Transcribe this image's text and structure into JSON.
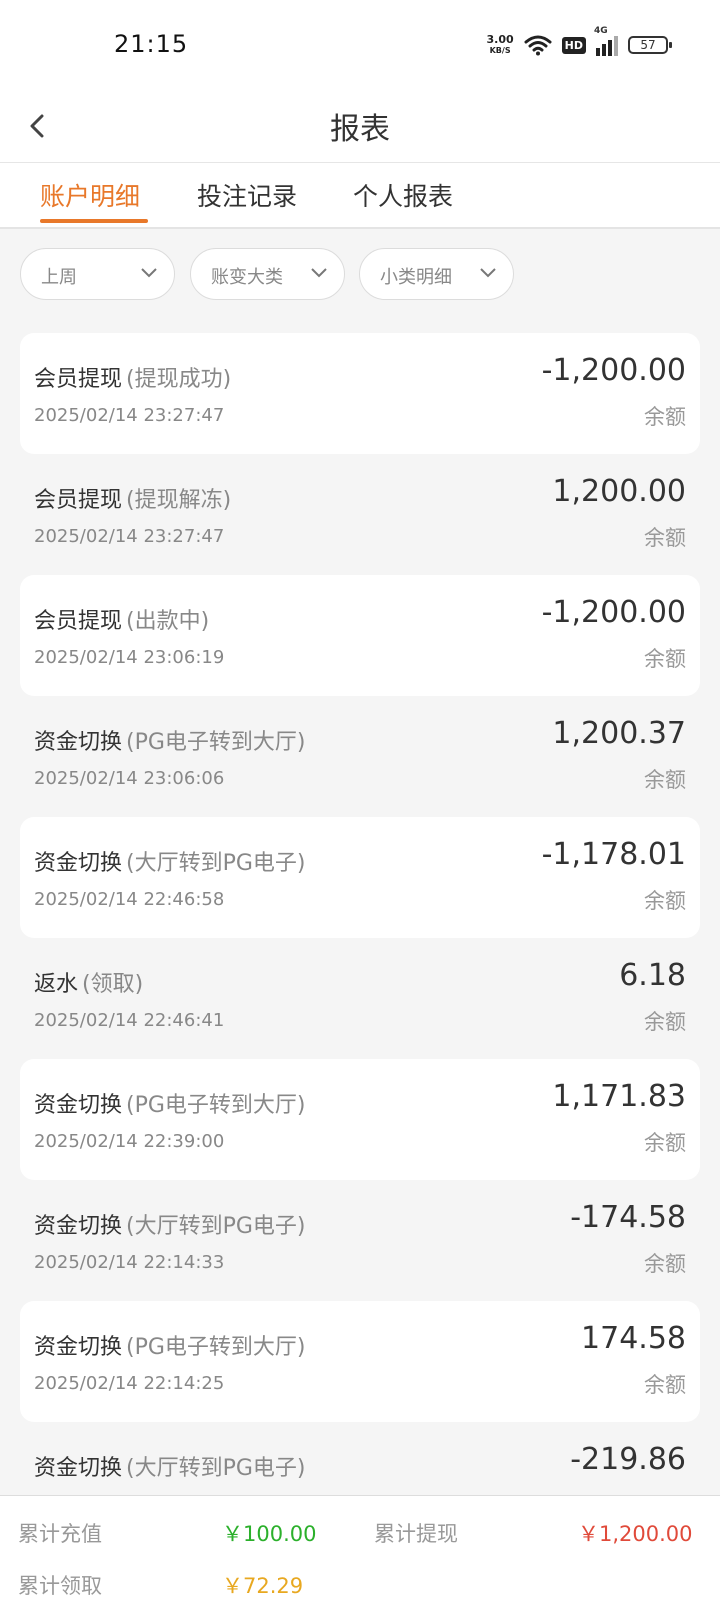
{
  "status_bar": {
    "time": "21:15",
    "net_speed_value": "3.00",
    "net_speed_unit": "KB/S",
    "hd_label": "HD",
    "network_label": "4G",
    "battery": "57"
  },
  "header": {
    "title": "报表"
  },
  "tabs": [
    {
      "label": "账户明细",
      "active": true
    },
    {
      "label": "投注记录",
      "active": false
    },
    {
      "label": "个人报表",
      "active": false
    }
  ],
  "filters": [
    {
      "label": "上周"
    },
    {
      "label": "账变大类"
    },
    {
      "label": "小类明细"
    }
  ],
  "records": [
    {
      "type": "会员提现",
      "detail": "(提现成功)",
      "time": "2025/02/14 23:27:47",
      "amount": "-1,200.00",
      "balance_label": "余额"
    },
    {
      "type": "会员提现",
      "detail": "(提现解冻)",
      "time": "2025/02/14 23:27:47",
      "amount": "1,200.00",
      "balance_label": "余额"
    },
    {
      "type": "会员提现",
      "detail": "(出款中)",
      "time": "2025/02/14 23:06:19",
      "amount": "-1,200.00",
      "balance_label": "余额"
    },
    {
      "type": "资金切换",
      "detail": "(PG电子转到大厅)",
      "time": "2025/02/14 23:06:06",
      "amount": "1,200.37",
      "balance_label": "余额"
    },
    {
      "type": "资金切换",
      "detail": "(大厅转到PG电子)",
      "time": "2025/02/14 22:46:58",
      "amount": "-1,178.01",
      "balance_label": "余额"
    },
    {
      "type": "返水",
      "detail": "(领取)",
      "time": "2025/02/14 22:46:41",
      "amount": "6.18",
      "balance_label": "余额"
    },
    {
      "type": "资金切换",
      "detail": "(PG电子转到大厅)",
      "time": "2025/02/14 22:39:00",
      "amount": "1,171.83",
      "balance_label": "余额"
    },
    {
      "type": "资金切换",
      "detail": "(大厅转到PG电子)",
      "time": "2025/02/14 22:14:33",
      "amount": "-174.58",
      "balance_label": "余额"
    },
    {
      "type": "资金切换",
      "detail": "(PG电子转到大厅)",
      "time": "2025/02/14 22:14:25",
      "amount": "174.58",
      "balance_label": "余额"
    },
    {
      "type": "资金切换",
      "detail": "(大厅转到PG电子)",
      "time": "",
      "amount": "-219.86",
      "balance_label": ""
    }
  ],
  "footer": {
    "total_deposit_label": "累计充值",
    "total_deposit_value": "￥100.00",
    "total_withdraw_label": "累计提现",
    "total_withdraw_value": "￥1,200.00",
    "total_claim_label": "累计领取",
    "total_claim_value": "￥72.29"
  },
  "colors": {
    "accent": "#e8782a",
    "deposit": "#2bb02b",
    "withdraw": "#e04a3a",
    "claim": "#e8a820"
  }
}
